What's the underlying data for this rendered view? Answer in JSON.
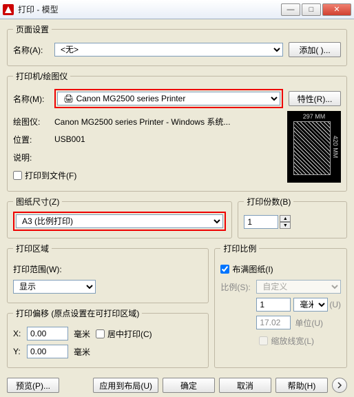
{
  "window": {
    "title": "打印 - 模型",
    "minimize": "—",
    "maximize": "□",
    "close": "✕"
  },
  "pageSetup": {
    "legend": "页面设置",
    "name_label": "名称(A):",
    "name_value": "<无>",
    "add_btn": "添加( )..."
  },
  "printer": {
    "legend": "打印机/绘图仪",
    "name_label": "名称(M):",
    "name_value": "Canon MG2500 series Printer",
    "props_btn": "特性(R)...",
    "plotter_label": "绘图仪:",
    "plotter_value": "Canon MG2500 series Printer - Windows 系统...",
    "location_label": "位置:",
    "location_value": "USB001",
    "desc_label": "说明:",
    "desc_value": "",
    "print_to_file": "打印到文件(F)",
    "preview_top": "297 MM",
    "preview_right": "420 MM"
  },
  "paperSize": {
    "legend": "图纸尺寸(Z)",
    "value": "A3 (比例打印)"
  },
  "copies": {
    "legend": "打印份数(B)",
    "value": "1"
  },
  "plotArea": {
    "legend": "打印区域",
    "range_label": "打印范围(W):",
    "range_value": "显示"
  },
  "offset": {
    "legend": "打印偏移 (原点设置在可打印区域)",
    "x_label": "X:",
    "x_value": "0.00",
    "y_label": "Y:",
    "y_value": "0.00",
    "unit": "毫米",
    "center": "居中打印(C)"
  },
  "scale": {
    "legend": "打印比例",
    "fit": "布满图纸(I)",
    "ratio_label": "比例(S):",
    "ratio_value": "自定义",
    "num1": "1",
    "unit1": "毫米",
    "unit1_suffix": "(U)",
    "num2": "17.02",
    "unit2": "单位(U)",
    "lineweight": "缩放线宽(L)"
  },
  "bottom": {
    "preview": "预览(P)...",
    "apply": "应用到布局(U)",
    "ok": "确定",
    "cancel": "取消",
    "help": "帮助(H)"
  }
}
